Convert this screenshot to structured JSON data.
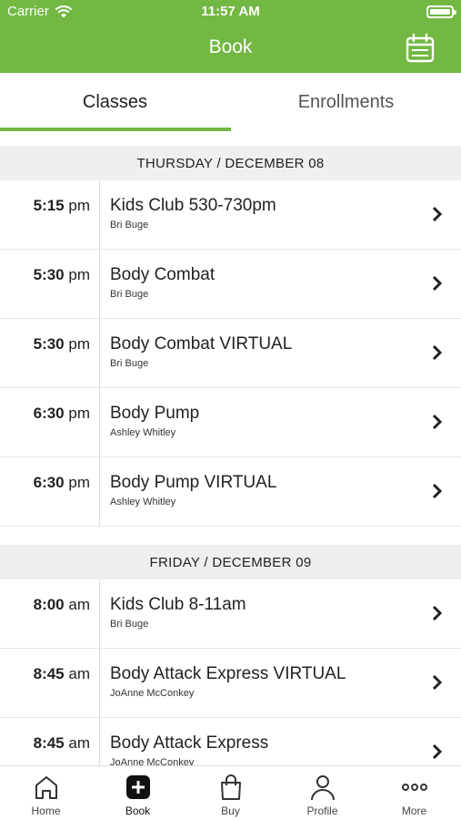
{
  "status": {
    "carrier": "Carrier",
    "time": "11:57 AM"
  },
  "header": {
    "title": "Book",
    "calendar_icon": "calendar-icon",
    "color": "#72b843"
  },
  "tabs": [
    {
      "label": "Classes",
      "active": true
    },
    {
      "label": "Enrollments",
      "active": false
    }
  ],
  "days": [
    {
      "label": "THURSDAY / DECEMBER 08",
      "classes": [
        {
          "time": "5:15",
          "ampm": "pm",
          "name": "Kids Club 530-730pm",
          "instructor": "Bri Buge"
        },
        {
          "time": "5:30",
          "ampm": "pm",
          "name": "Body Combat",
          "instructor": "Bri Buge"
        },
        {
          "time": "5:30",
          "ampm": "pm",
          "name": "Body Combat VIRTUAL",
          "instructor": "Bri Buge"
        },
        {
          "time": "6:30",
          "ampm": "pm",
          "name": "Body Pump",
          "instructor": "Ashley Whitley"
        },
        {
          "time": "6:30",
          "ampm": "pm",
          "name": "Body Pump VIRTUAL",
          "instructor": "Ashley Whitley"
        }
      ]
    },
    {
      "label": "FRIDAY / DECEMBER 09",
      "classes": [
        {
          "time": "8:00",
          "ampm": "am",
          "name": "Kids Club 8-11am",
          "instructor": "Bri Buge"
        },
        {
          "time": "8:45",
          "ampm": "am",
          "name": "Body Attack Express VIRTUAL",
          "instructor": "JoAnne McConkey"
        },
        {
          "time": "8:45",
          "ampm": "am",
          "name": "Body Attack Express",
          "instructor": "JoAnne McConkey"
        }
      ]
    }
  ],
  "tabbar": [
    {
      "label": "Home",
      "icon": "home-icon"
    },
    {
      "label": "Book",
      "icon": "plus-square-icon",
      "active": true
    },
    {
      "label": "Buy",
      "icon": "shopping-bag-icon"
    },
    {
      "label": "Profile",
      "icon": "person-icon"
    },
    {
      "label": "More",
      "icon": "more-dots-icon"
    }
  ]
}
